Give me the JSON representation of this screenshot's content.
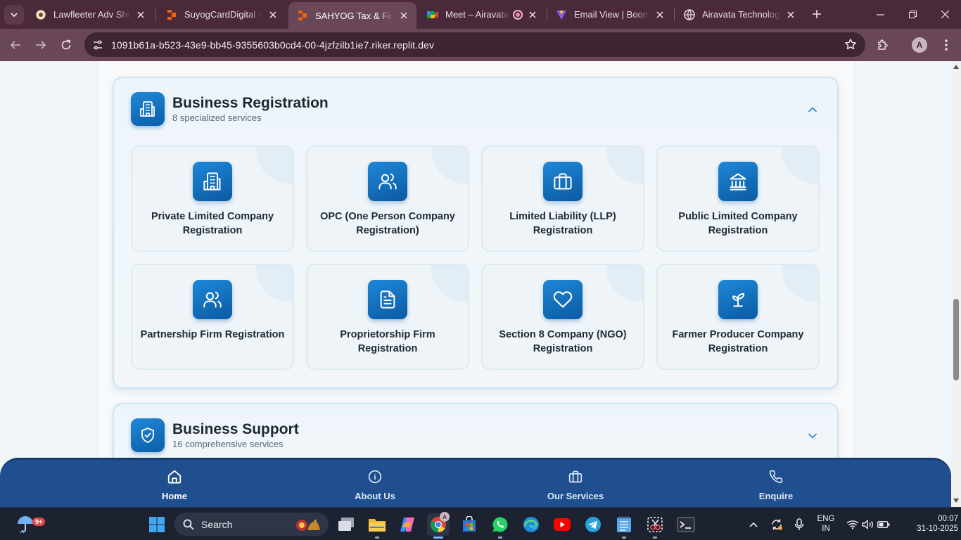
{
  "browser": {
    "tabs": [
      {
        "title": "Lawfleeter Adv Shivaraj",
        "favicon": "lawfleeter-icon",
        "active": false
      },
      {
        "title": "SuyogCardDigital - Replit",
        "favicon": "replit-icon",
        "active": false
      },
      {
        "title": "SAHYOG Tax & Financial",
        "favicon": "replit-icon",
        "active": true
      },
      {
        "title": "Meet – Airavata Meeting",
        "favicon": "meet-icon",
        "active": false
      },
      {
        "title": "Email View | Boomlify",
        "favicon": "boomlify-icon",
        "active": false
      },
      {
        "title": "Airavata Technologies",
        "favicon": "globe-icon",
        "active": false
      }
    ],
    "url": "1091b61a-b523-43e9-bb45-9355603b0cd4-00-4jzfzilb1ie7.riker.replit.dev",
    "profile_initial": "A"
  },
  "sections": [
    {
      "title": "Business Registration",
      "subtitle": "8 specialized services",
      "expanded": true,
      "icon": "building-icon",
      "services": [
        {
          "label": "Private Limited Company Registration",
          "icon": "building-icon"
        },
        {
          "label": "OPC (One Person Company Registration)",
          "icon": "users-icon"
        },
        {
          "label": "Limited Liability (LLP) Registration",
          "icon": "briefcase-icon"
        },
        {
          "label": "Public Limited Company Registration",
          "icon": "landmark-icon"
        },
        {
          "label": "Partnership Firm Registration",
          "icon": "users-icon"
        },
        {
          "label": "Proprietorship Firm Registration",
          "icon": "document-icon"
        },
        {
          "label": "Section 8 Company (NGO) Registration",
          "icon": "heart-icon"
        },
        {
          "label": "Farmer Producer Company Registration",
          "icon": "sprout-icon"
        }
      ]
    },
    {
      "title": "Business Support",
      "subtitle": "16 comprehensive services",
      "expanded": false,
      "icon": "shield-check-icon"
    }
  ],
  "bottom_nav": [
    {
      "label": "Home",
      "icon": "home-icon",
      "active": true
    },
    {
      "label": "About Us",
      "icon": "info-icon",
      "active": false
    },
    {
      "label": "Our Services",
      "icon": "briefcase-icon",
      "active": false
    },
    {
      "label": "Enquire",
      "icon": "phone-icon",
      "active": false
    }
  ],
  "taskbar": {
    "weather_badge": "9+",
    "search_label": "Search",
    "language": "ENG",
    "region": "IN",
    "time": "00:07",
    "date": "31-10-2025"
  },
  "colors": {
    "accent": "#1877c9",
    "nav_bg": "#1f4f8f",
    "tab_bar": "#4a2a3a",
    "active_tab": "#6a4659"
  }
}
